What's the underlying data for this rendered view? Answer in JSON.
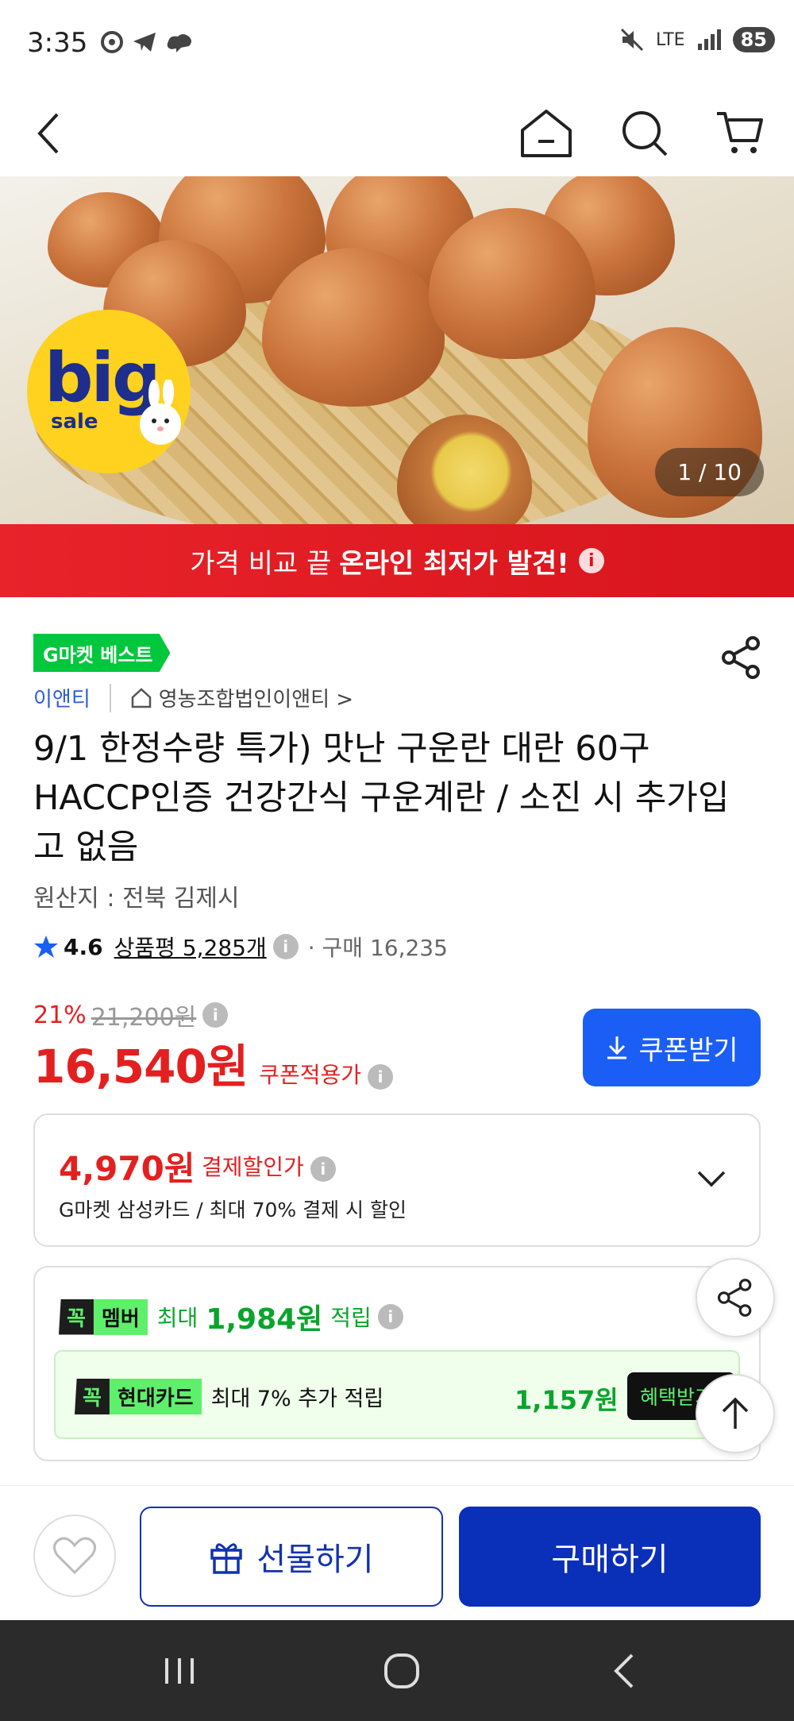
{
  "status_bar": {
    "time": "3:35",
    "network": "LTE",
    "battery": "85"
  },
  "hero": {
    "badge_big": "big",
    "badge_sale": "sale",
    "counter": "1 / 10"
  },
  "promo_banner": {
    "text": "가격 비교 끝",
    "highlight": "온라인 최저가 발견!",
    "info": "i"
  },
  "product": {
    "best_badge": "G마켓 베스트",
    "seller": "이앤티",
    "shop": "영농조합법인이앤티 >",
    "title": "9/1 한정수량 특가) 맛난 구운란 대란 60구 HACCP인증 건강간식 구운계란 / 소진 시 추가입고 없음",
    "origin": "원산지 : 전북 김제시",
    "rating": "4.6",
    "reviews": "상품평 5,285개",
    "purchases": "· 구매 16,235",
    "discount_pct": "21%",
    "original_price": "21,200원",
    "price": "16,540원",
    "price_label": "쿠폰적용가",
    "coupon_button": "쿠폰받기"
  },
  "payment": {
    "price": "4,970원",
    "label": "결제할인가",
    "desc": "G마켓 삼성카드 / 최대 70% 결제 시 할인"
  },
  "membership": {
    "tag_kk": "꼭",
    "tag_member": "멤버",
    "prefix": "최대",
    "amount": "1,984원",
    "suffix": "적립",
    "card_tag_kk": "꼭",
    "card_name": "현대카드",
    "card_desc": "최대 7% 추가 적립",
    "card_amount": "1,157원",
    "benefit_button": "혜택받기"
  },
  "bottom_bar": {
    "gift_label": "선물하기",
    "buy_label": "구매하기"
  },
  "colors": {
    "accent_red": "#e32020",
    "coupon_blue": "#1b5ef5",
    "buy_blue": "#0a2fb8",
    "gmarket_green": "#00c73c"
  }
}
